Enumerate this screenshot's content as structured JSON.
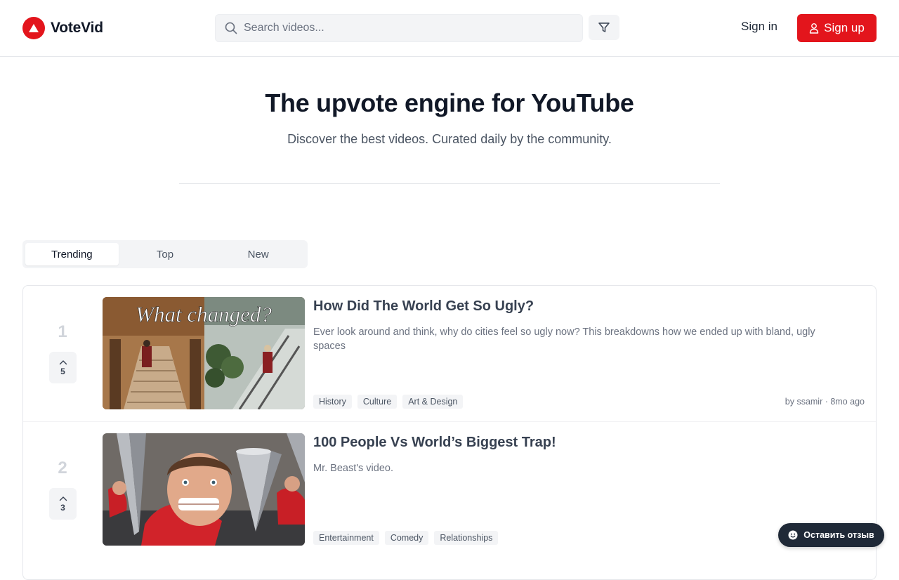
{
  "header": {
    "brand": "VoteVid",
    "brand_color": "#e3151c",
    "search": {
      "placeholder": "Search videos...",
      "value": ""
    },
    "filter_icon": "filter-icon",
    "signin_label": "Sign in",
    "signup_label": "Sign up"
  },
  "hero": {
    "title": "The upvote engine for YouTube",
    "subtitle": "Discover the best videos. Curated daily by the community."
  },
  "tabs": [
    {
      "label": "Trending",
      "active": true
    },
    {
      "label": "Top",
      "active": false
    },
    {
      "label": "New",
      "active": false
    }
  ],
  "videos": [
    {
      "rank": "1",
      "votes": "5",
      "title": "How Did The World Get So Ugly?",
      "description": "Ever look around and think, why do cities feel so ugly now? This breakdowns how we ended up with bland, ugly spaces",
      "thumbnail_text": "What changed?",
      "tags": [
        "History",
        "Culture",
        "Art & Design"
      ],
      "meta": "by ssamir · 8mo ago"
    },
    {
      "rank": "2",
      "votes": "3",
      "title": "100 People Vs World’s Biggest Trap!",
      "description": "Mr. Beast's video.",
      "tags": [
        "Entertainment",
        "Comedy",
        "Relationships"
      ],
      "meta": ""
    }
  ],
  "feedback_label": "Оставить отзыв"
}
